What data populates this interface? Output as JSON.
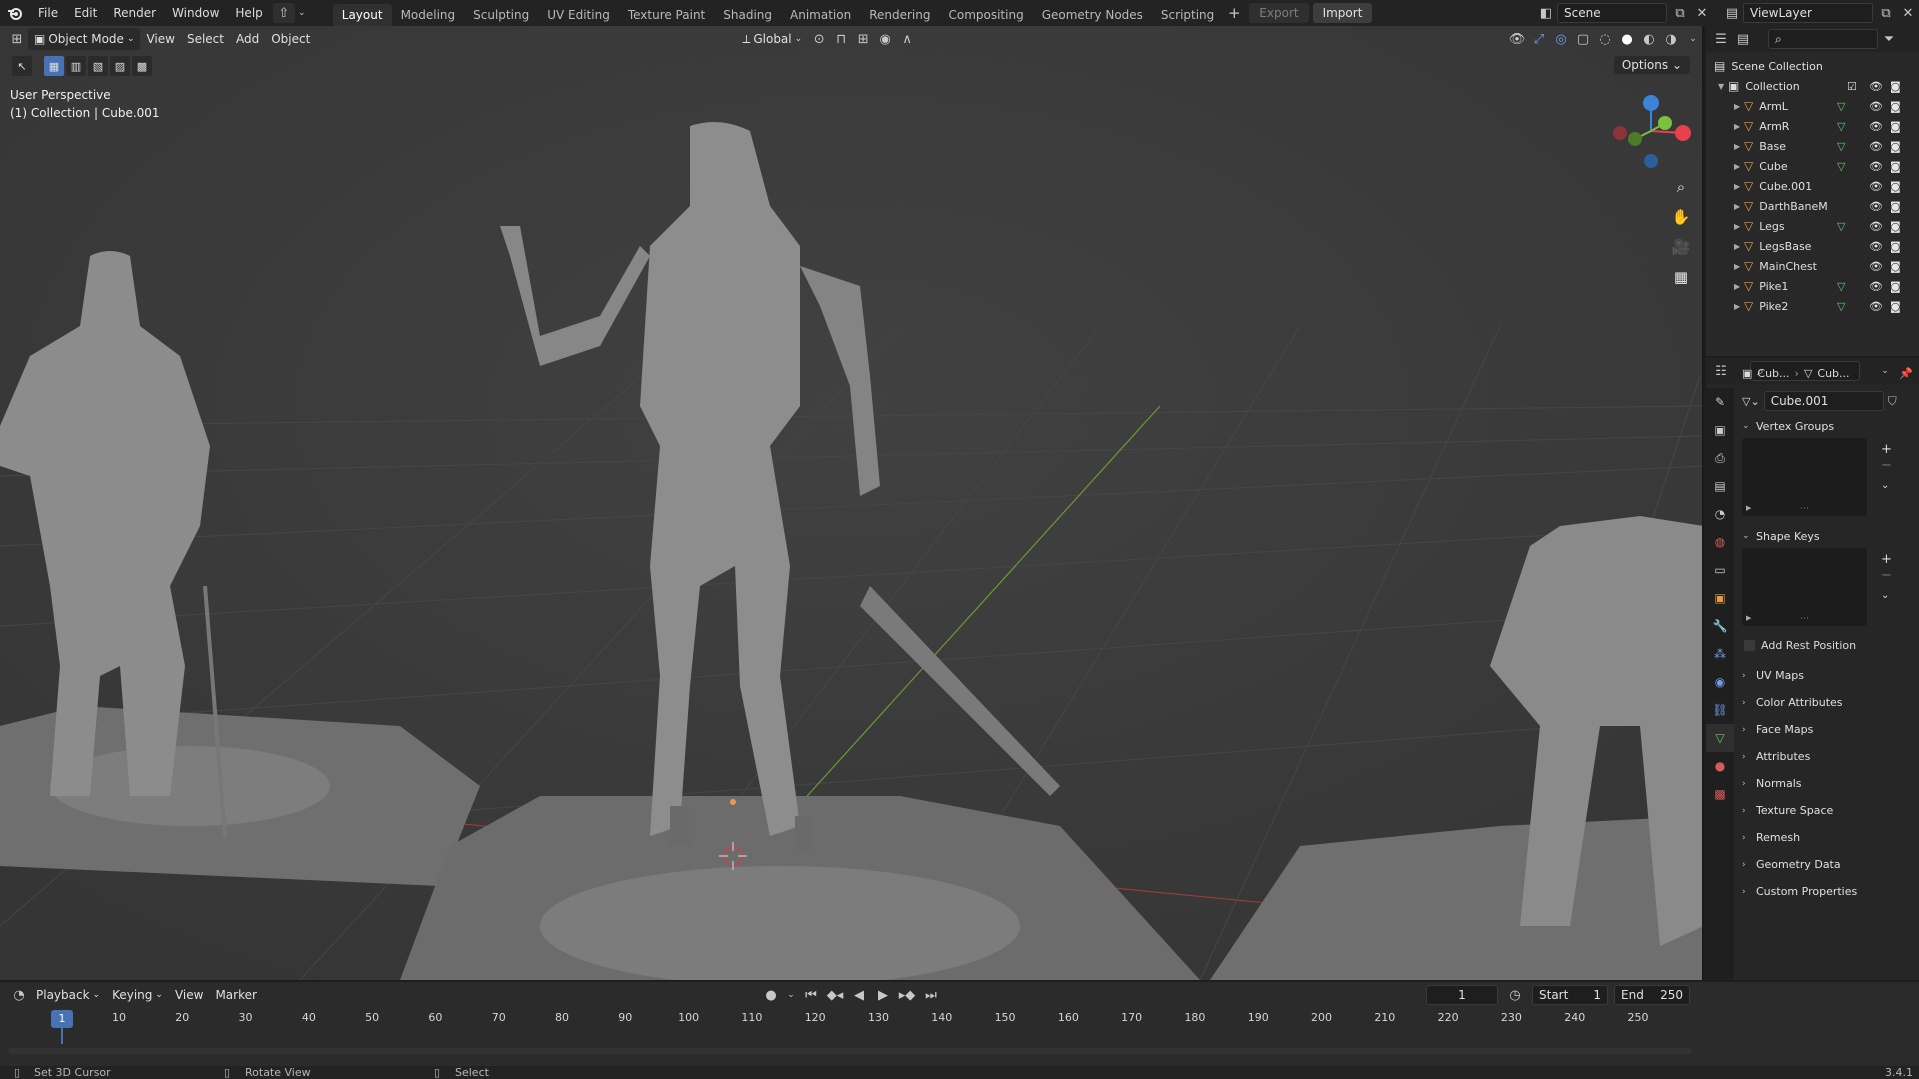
{
  "topbar": {
    "menu": [
      "File",
      "Edit",
      "Render",
      "Window",
      "Help"
    ],
    "workspaces": [
      "Layout",
      "Modeling",
      "Sculpting",
      "UV Editing",
      "Texture Paint",
      "Shading",
      "Animation",
      "Rendering",
      "Compositing",
      "Geometry Nodes",
      "Scripting"
    ],
    "active_workspace": "Layout",
    "export_label": "Export",
    "import_label": "Import",
    "scene_name": "Scene",
    "view_layer": "ViewLayer"
  },
  "viewport": {
    "mode": "Object Mode",
    "menus": [
      "View",
      "Select",
      "Add",
      "Object"
    ],
    "orientation": "Global",
    "options_label": "Options",
    "perspective": "User Perspective",
    "collection_info": "(1) Collection | Cube.001",
    "axis_labels": {
      "z": "Z",
      "y": "Y",
      "x": "X"
    }
  },
  "outliner": {
    "root": "Scene Collection",
    "collection": "Collection",
    "objects": [
      {
        "name": "ArmL",
        "mesh": true
      },
      {
        "name": "ArmR",
        "mesh": true
      },
      {
        "name": "Base",
        "mesh": true
      },
      {
        "name": "Cube",
        "mesh": true
      },
      {
        "name": "Cube.001",
        "mesh": false
      },
      {
        "name": "DarthBaneM",
        "mesh": false
      },
      {
        "name": "Legs",
        "mesh": true
      },
      {
        "name": "LegsBase",
        "mesh": false
      },
      {
        "name": "MainChest",
        "mesh": false
      },
      {
        "name": "Pike1",
        "mesh": true
      },
      {
        "name": "Pike2",
        "mesh": true
      }
    ]
  },
  "properties": {
    "breadcrumb_object": "Cub...",
    "breadcrumb_data": "Cub...",
    "mesh_name": "Cube.001",
    "vertex_groups": "Vertex Groups",
    "shape_keys": "Shape Keys",
    "add_rest_position": "Add Rest Position",
    "panels": [
      "UV Maps",
      "Color Attributes",
      "Face Maps",
      "Attributes",
      "Normals",
      "Texture Space",
      "Remesh",
      "Geometry Data",
      "Custom Properties"
    ]
  },
  "timeline": {
    "menus": [
      "Playback",
      "Keying",
      "View",
      "Marker"
    ],
    "current_frame": "1",
    "start_label": "Start",
    "start": "1",
    "end_label": "End",
    "end": "250",
    "ticks": [
      "1",
      "10",
      "20",
      "30",
      "40",
      "50",
      "60",
      "70",
      "80",
      "90",
      "100",
      "110",
      "120",
      "130",
      "140",
      "150",
      "160",
      "170",
      "180",
      "190",
      "200",
      "210",
      "220",
      "230",
      "240",
      "250"
    ]
  },
  "statusbar": {
    "left": "Set 3D Cursor",
    "middle": "Rotate View",
    "right": "Select",
    "version": "3.4.1"
  },
  "colors": {
    "accent": "#4772b3",
    "object_orange": "#e99c46",
    "mesh_green": "#6cc46a",
    "axis_x": "#e8414c",
    "axis_y": "#7ac13d",
    "axis_z": "#3b84d8"
  }
}
